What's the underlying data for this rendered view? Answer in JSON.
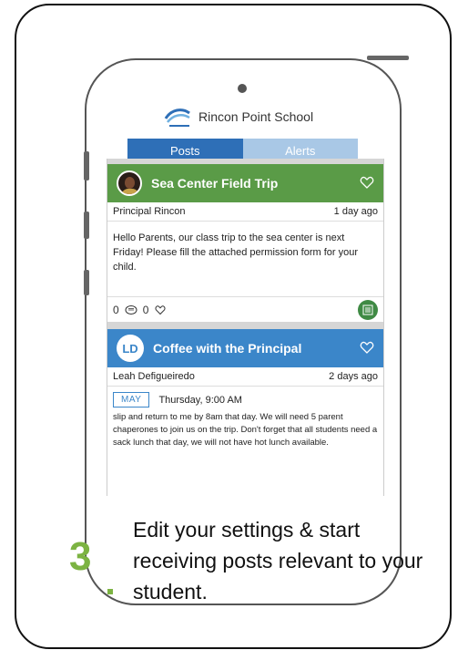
{
  "school": {
    "name": "Rincon Point School"
  },
  "tabs": [
    {
      "label": "Posts",
      "active": true
    },
    {
      "label": "Alerts",
      "active": false
    }
  ],
  "posts": [
    {
      "title": "Sea Center Field Trip",
      "author": "Principal Rincon",
      "time": "1 day ago",
      "body": "Hello Parents, our class trip to the sea center is next Friday! Please fill the attached permission form for your child.",
      "comments": "0",
      "likes": "0",
      "header_color": "#5a9b47"
    },
    {
      "title": "Coffee with the Principal",
      "avatar_initials": "LD",
      "author": "Leah Defigueiredo",
      "time": "2 days ago",
      "event_month": "MAY",
      "event_time": "Thursday, 9:00 AM",
      "body": "slip and return to me by 8am that day. We will need 5 parent chaperones to join us on the trip. Don't forget that all students need a sack lunch that day, we will not have hot lunch available.",
      "header_color": "#3b86c9"
    }
  ],
  "step": {
    "number": "3",
    "text": "Edit your settings & start receiving posts relevant to your student."
  }
}
